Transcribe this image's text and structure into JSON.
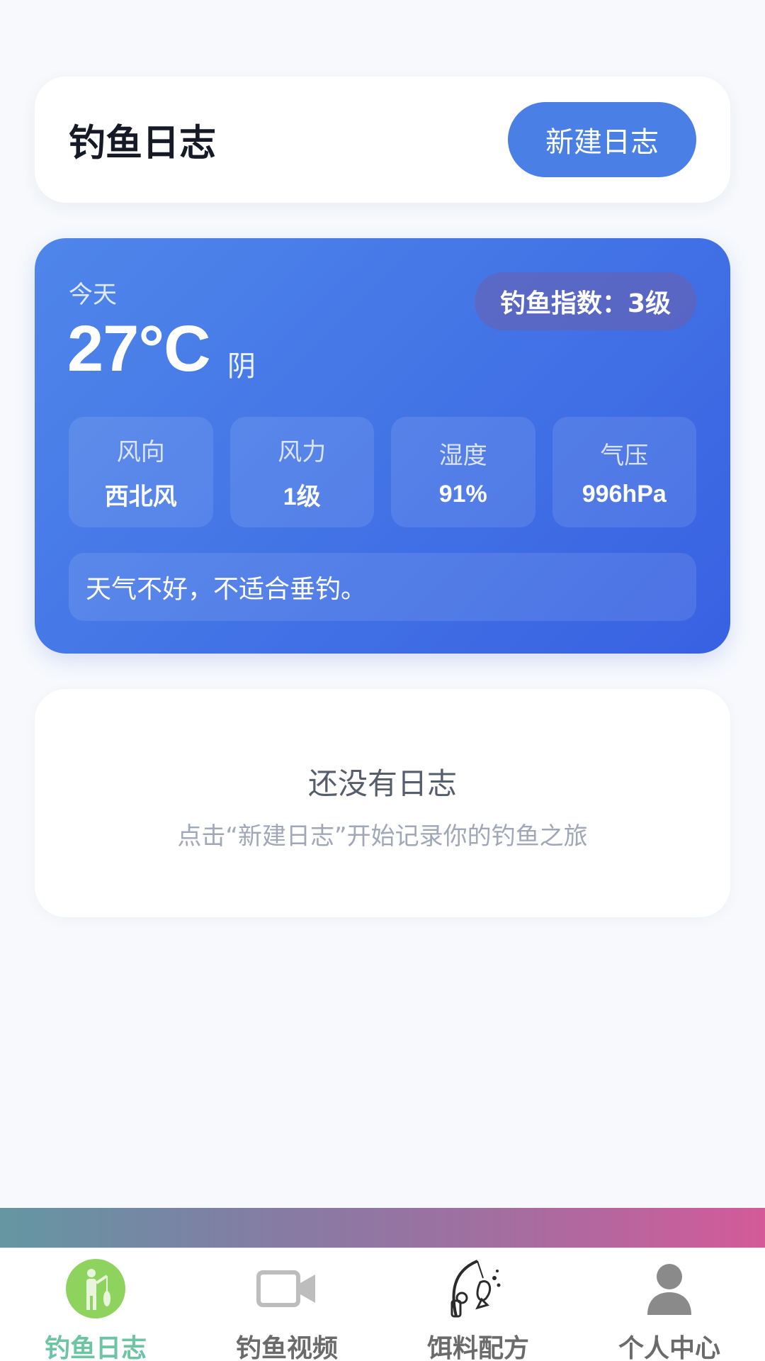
{
  "header": {
    "title": "钓鱼日志",
    "new_button": "新建日志"
  },
  "weather": {
    "day_label": "今天",
    "temperature": "27°C",
    "condition": "阴",
    "fishing_index": "钓鱼指数：3级",
    "stats": [
      {
        "label": "风向",
        "value": "西北风"
      },
      {
        "label": "风力",
        "value": "1级"
      },
      {
        "label": "湿度",
        "value": "91%"
      },
      {
        "label": "气压",
        "value": "996hPa"
      }
    ],
    "tip": "天气不好，不适合垂钓。"
  },
  "empty_state": {
    "title": "还没有日志",
    "hint": "点击“新建日志”开始记录你的钓鱼之旅"
  },
  "tabbar": {
    "active_color": "#6cc4a4",
    "items": [
      {
        "label": "钓鱼日志",
        "icon": "fisherman-icon",
        "active": true
      },
      {
        "label": "钓鱼视频",
        "icon": "video-camera-icon",
        "active": false
      },
      {
        "label": "饵料配方",
        "icon": "fishing-rod-icon",
        "active": false
      },
      {
        "label": "个人中心",
        "icon": "user-icon",
        "active": false
      }
    ]
  }
}
